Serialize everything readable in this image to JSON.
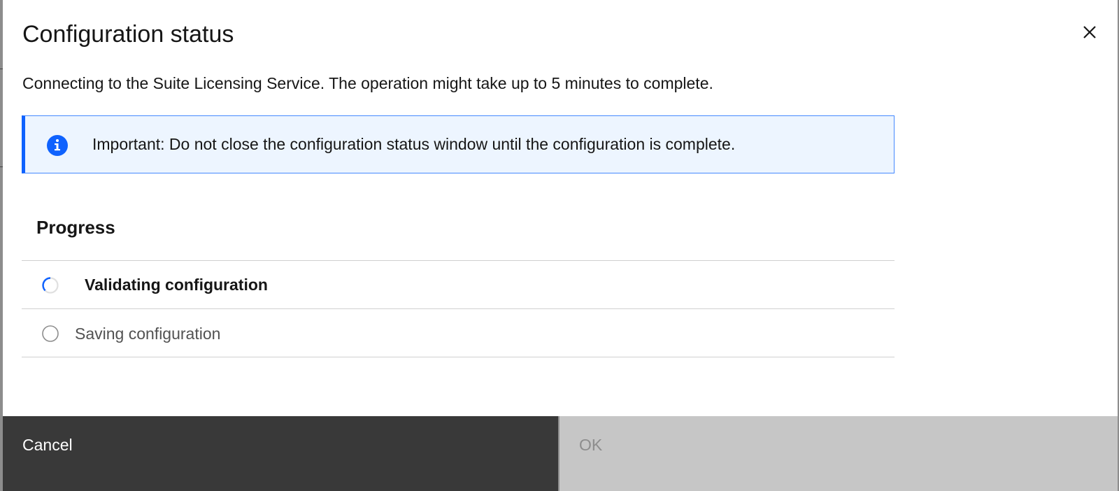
{
  "dialog": {
    "title": "Configuration status",
    "description": "Connecting to the Suite Licensing Service. The operation might take up to 5 minutes to complete.",
    "close_icon": "close-icon"
  },
  "notification": {
    "icon": "info-icon",
    "text": "Important: Do not close the configuration status window until the configuration is complete.",
    "accent_color": "#0f62fe",
    "background_color": "#edf5ff"
  },
  "progress": {
    "heading": "Progress",
    "steps": [
      {
        "label": "Validating configuration",
        "status": "in-progress",
        "icon": "loading-spinner-icon"
      },
      {
        "label": "Saving configuration",
        "status": "pending",
        "icon": "radio-circle-icon"
      }
    ]
  },
  "footer": {
    "cancel_label": "Cancel",
    "ok_label": "OK",
    "ok_disabled": true
  }
}
